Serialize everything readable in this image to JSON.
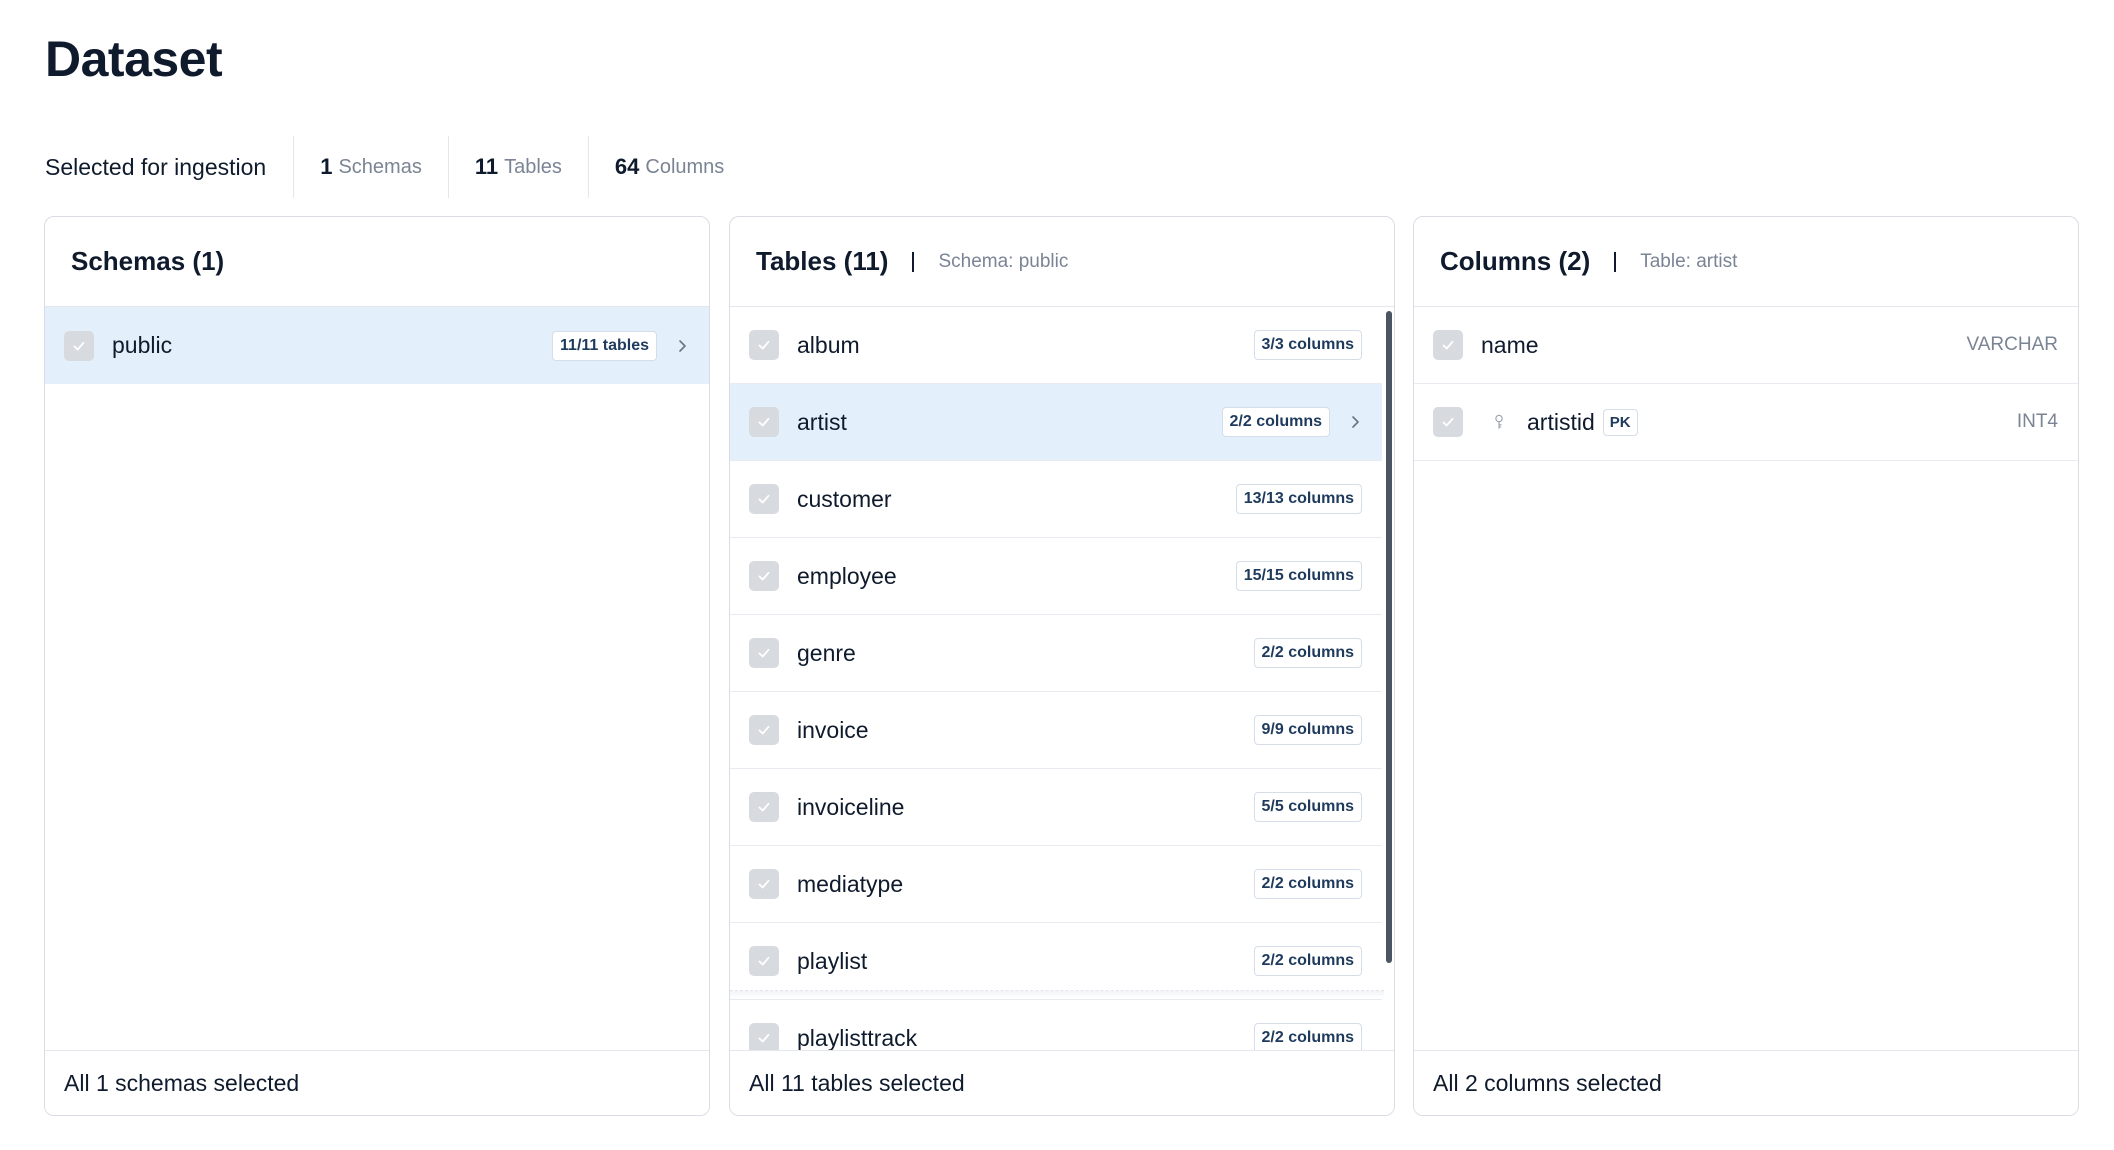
{
  "page": {
    "title": "Dataset"
  },
  "summary": {
    "label": "Selected for ingestion",
    "schemas": {
      "count": "1",
      "unit": "Schemas"
    },
    "tables": {
      "count": "11",
      "unit": "Tables"
    },
    "columns": {
      "count": "64",
      "unit": "Columns"
    }
  },
  "schemas_panel": {
    "title": "Schemas (1)",
    "items": [
      {
        "label": "public",
        "badge": "11/11 tables",
        "checked": true,
        "selected": true
      }
    ],
    "footer": "All 1 schemas selected"
  },
  "tables_panel": {
    "title": "Tables (11)",
    "subtitle": "Schema: public",
    "items": [
      {
        "label": "album",
        "badge": "3/3 columns",
        "checked": true
      },
      {
        "label": "artist",
        "badge": "2/2 columns",
        "checked": true,
        "selected": true
      },
      {
        "label": "customer",
        "badge": "13/13 columns",
        "checked": true
      },
      {
        "label": "employee",
        "badge": "15/15 columns",
        "checked": true
      },
      {
        "label": "genre",
        "badge": "2/2 columns",
        "checked": true
      },
      {
        "label": "invoice",
        "badge": "9/9 columns",
        "checked": true
      },
      {
        "label": "invoiceline",
        "badge": "5/5 columns",
        "checked": true
      },
      {
        "label": "mediatype",
        "badge": "2/2 columns",
        "checked": true
      },
      {
        "label": "playlist",
        "badge": "2/2 columns",
        "checked": true
      },
      {
        "label": "playlisttrack",
        "badge": "2/2 columns",
        "checked": true
      }
    ],
    "footer": "All 11 tables selected"
  },
  "columns_panel": {
    "title": "Columns (2)",
    "subtitle": "Table: artist",
    "items": [
      {
        "label": "name",
        "type": "VARCHAR",
        "checked": true
      },
      {
        "label": "artistid",
        "type": "INT4",
        "checked": true,
        "pk": "PK",
        "icon": "key-icon"
      }
    ],
    "footer": "All 2 columns selected"
  },
  "colors": {
    "selected_row": "#e3f0fb",
    "checkbox": "#d7dade",
    "badge_text": "#1e3a5c",
    "muted_text": "#7a8494"
  }
}
